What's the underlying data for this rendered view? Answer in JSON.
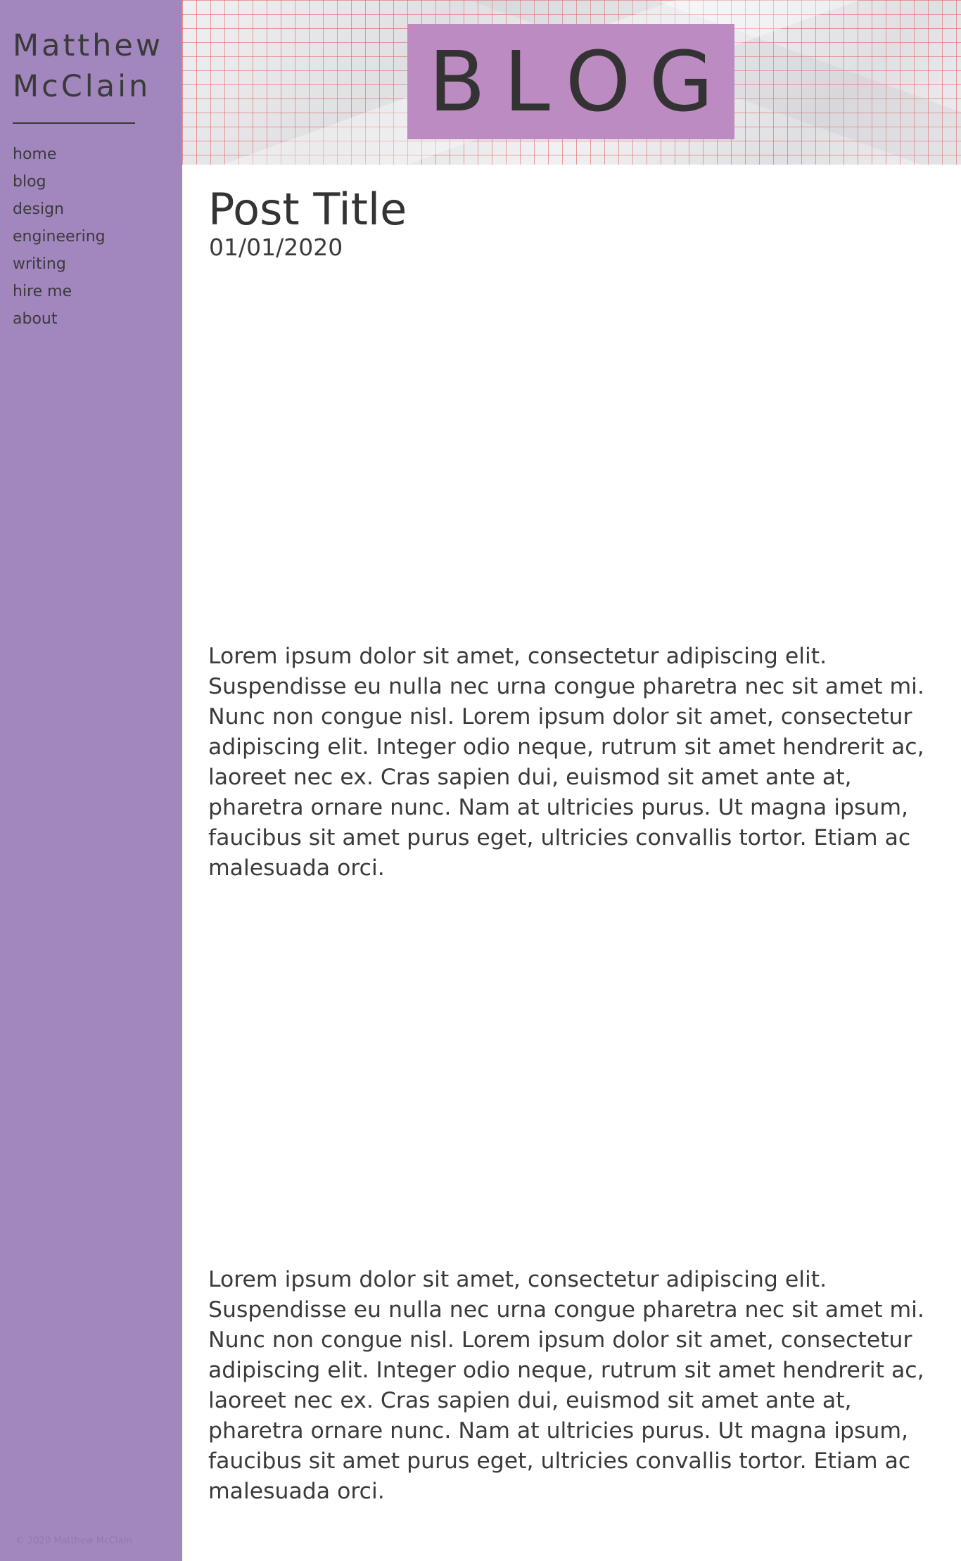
{
  "sidebar": {
    "site_name_line1": "Matthew",
    "site_name_line2": "McClain",
    "nav": [
      {
        "label": "home"
      },
      {
        "label": "blog"
      },
      {
        "label": "design"
      },
      {
        "label": "engineering"
      },
      {
        "label": "writing"
      },
      {
        "label": "hire me"
      },
      {
        "label": "about"
      }
    ],
    "copyright": "© 2020 Matthew McClain",
    "background_color": "#a287bf"
  },
  "header": {
    "banner_title": "BLOG",
    "banner_box_color": "#bb8bc1"
  },
  "post": {
    "title": "Post Title",
    "date": "01/01/2020",
    "paragraphs": [
      "Lorem ipsum dolor sit amet, consectetur adipiscing elit. Suspendisse eu nulla nec urna congue pharetra nec sit amet mi. Nunc non congue nisl. Lorem ipsum dolor sit amet, consectetur adipiscing elit. Integer odio neque, rutrum sit amet hendrerit ac, laoreet nec ex. Cras sapien dui, euismod sit amet ante at, pharetra ornare nunc. Nam at ultricies purus. Ut magna ipsum, faucibus sit amet purus eget, ultricies convallis tortor. Etiam ac malesuada orci.",
      "Lorem ipsum dolor sit amet, consectetur adipiscing elit. Suspendisse eu nulla nec urna congue pharetra nec sit amet mi. Nunc non congue nisl. Lorem ipsum dolor sit amet, consectetur adipiscing elit. Integer odio neque, rutrum sit amet hendrerit ac, laoreet nec ex. Cras sapien dui, euismod sit amet ante at, pharetra ornare nunc. Nam at ultricies purus. Ut magna ipsum, faucibus sit amet purus eget, ultricies convallis tortor. Etiam ac malesuada orci."
    ]
  }
}
